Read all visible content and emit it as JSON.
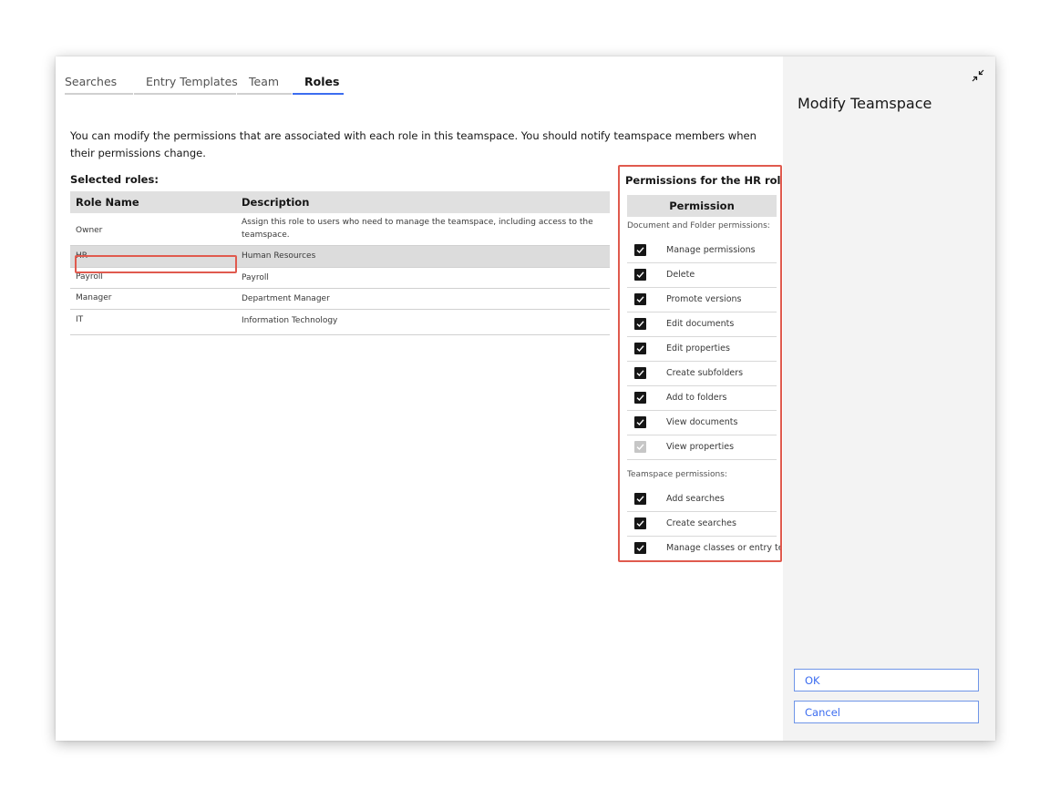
{
  "tabs": [
    {
      "label": "Searches",
      "active": false
    },
    {
      "label": "Entry Templates",
      "active": false
    },
    {
      "label": "Team",
      "active": false
    },
    {
      "label": "Roles",
      "active": true
    }
  ],
  "intro_text": "You can modify the permissions that are associated with each role in this teamspace. You should notify teamspace members when their permissions change.",
  "roles": {
    "label": "Selected roles:",
    "columns": [
      "Role Name",
      "Description"
    ],
    "rows": [
      {
        "name": "Owner",
        "description": "Assign this role to users who need to manage the teamspace, including access to the teamspace.",
        "selected": false
      },
      {
        "name": "HR",
        "description": "Human Resources",
        "selected": true
      },
      {
        "name": "Payroll",
        "description": "Payroll",
        "selected": false
      },
      {
        "name": "Manager",
        "description": "Department Manager",
        "selected": false
      },
      {
        "name": "IT",
        "description": "Information Technology",
        "selected": false
      }
    ]
  },
  "permissions": {
    "title": "Permissions for the HR role:",
    "column": "Permission",
    "doc_section": "Document and Folder permissions:",
    "doc_items": [
      {
        "label": "Manage permissions",
        "checked": true,
        "disabled": false
      },
      {
        "label": "Delete",
        "checked": true,
        "disabled": false
      },
      {
        "label": "Promote versions",
        "checked": true,
        "disabled": false
      },
      {
        "label": "Edit documents",
        "checked": true,
        "disabled": false
      },
      {
        "label": "Edit properties",
        "checked": true,
        "disabled": false
      },
      {
        "label": "Create subfolders",
        "checked": true,
        "disabled": false
      },
      {
        "label": "Add to folders",
        "checked": true,
        "disabled": false
      },
      {
        "label": "View documents",
        "checked": true,
        "disabled": false
      },
      {
        "label": "View properties",
        "checked": true,
        "disabled": true
      }
    ],
    "team_section": "Teamspace permissions:",
    "team_items": [
      {
        "label": "Add searches",
        "checked": true,
        "disabled": false
      },
      {
        "label": "Create searches",
        "checked": true,
        "disabled": false
      },
      {
        "label": "Manage classes or entry te",
        "checked": true,
        "disabled": false
      }
    ]
  },
  "side_panel": {
    "title": "Modify Teamspace",
    "collapse_icon": "minimize-arrows-icon",
    "ok_label": "OK",
    "cancel_label": "Cancel"
  },
  "colors": {
    "accent": "#3c6df0",
    "highlight": "#e05a4e",
    "side_bg": "#f3f3f3"
  }
}
